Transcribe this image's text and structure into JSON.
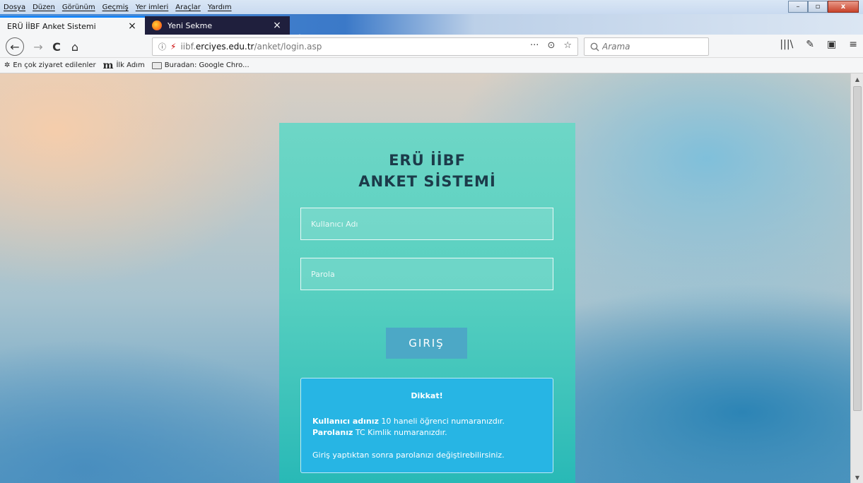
{
  "menu": [
    "Dosya",
    "Düzen",
    "Görünüm",
    "Geçmiş",
    "Yer imleri",
    "Araçlar",
    "Yardım"
  ],
  "tabs": [
    {
      "title": "ERÜ İİBF Anket Sistemi",
      "close": "×"
    },
    {
      "title": "Yeni Sekme",
      "close": "×"
    }
  ],
  "newtab": "+",
  "nav": {
    "back": "←",
    "forward": "→",
    "reload": "C",
    "home": "⌂"
  },
  "url": {
    "info": "ⓘ",
    "lock": "⚡",
    "domain_pre": "iibf.",
    "domain": "erciyes.edu.tr",
    "path": "/anket/login.asp",
    "actions": [
      "···",
      "⊙",
      "☆"
    ]
  },
  "search": {
    "placeholder": "Arama"
  },
  "toolbar_icons": [
    "|||\\",
    "✎",
    "▣",
    "≡"
  ],
  "bookmarks": [
    {
      "icon": "✲",
      "label": "En çok ziyaret edilenler"
    },
    {
      "icon": "m",
      "label": "İlk Adım"
    },
    {
      "icon": "folder",
      "label": "Buradan: Google Chro..."
    }
  ],
  "window_controls": {
    "minimize": "–",
    "maximize": "▫",
    "close": "x"
  },
  "login": {
    "title_line1": "ERÜ İİBF",
    "title_line2": "ANKET SİSTEMİ",
    "username_placeholder": "Kullanıcı Adı",
    "password_placeholder": "Parola",
    "button": "GIRIŞ",
    "notice": {
      "title": "Dikkat!",
      "line1_bold": "Kullanıcı adınız",
      "line1_rest": " 10 haneli öğrenci numaranızdır.",
      "line2_bold": "Parolanız",
      "line2_rest": " TC Kimlik numaranızdır.",
      "line3": "Giriş yaptıktan sonra parolanızı değiştirebilirsiniz."
    }
  },
  "colors": {
    "card_top": "#6ed6c6",
    "card_bottom": "#27b8b6",
    "button": "#4ca8c6",
    "notice": "#27b5e4",
    "title": "#1c3b4a"
  }
}
